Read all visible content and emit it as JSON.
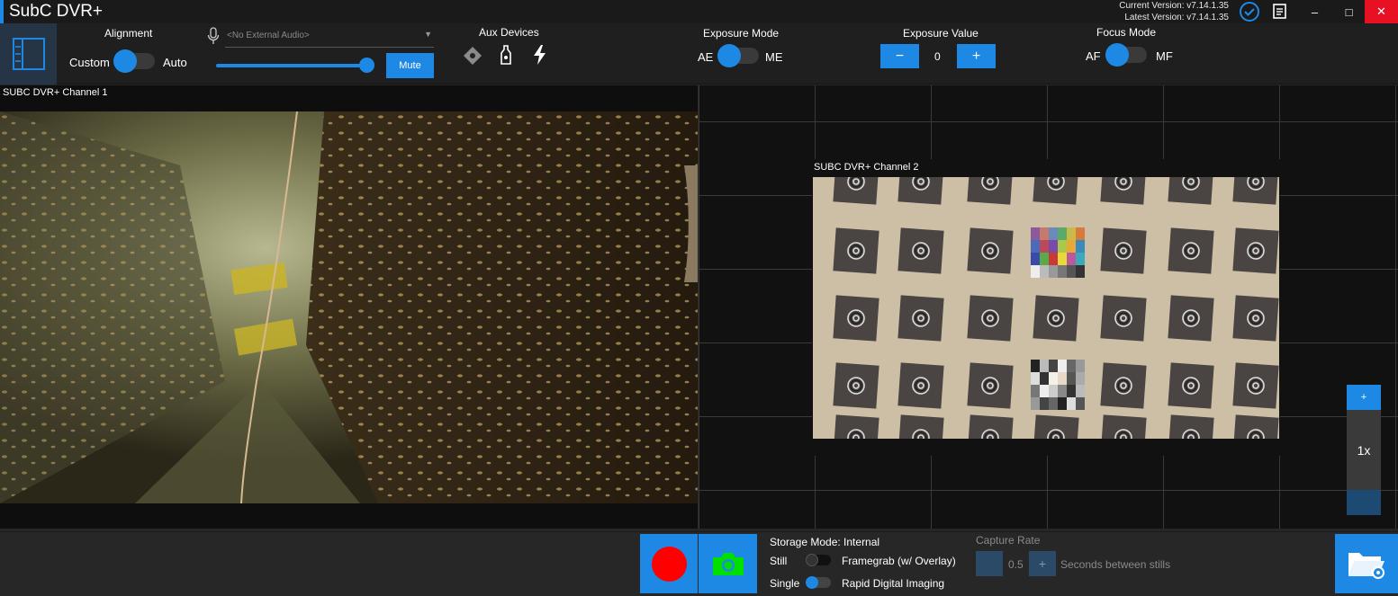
{
  "app": {
    "title": "SubC DVR+",
    "current_version": "Current Version: v7.14.1.35",
    "latest_version": "Latest Version: v7.14.1.35"
  },
  "toolbar": {
    "alignment": {
      "label": "Alignment",
      "left": "Custom",
      "right": "Auto"
    },
    "audio": {
      "placeholder": "<No External Audio>",
      "mute": "Mute"
    },
    "aux": {
      "label": "Aux Devices"
    },
    "exposure_mode": {
      "label": "Exposure Mode",
      "left": "AE",
      "right": "ME"
    },
    "exposure_value": {
      "label": "Exposure Value",
      "minus": "−",
      "value": "0",
      "plus": "+"
    },
    "focus_mode": {
      "label": "Focus Mode",
      "left": "AF",
      "right": "MF"
    }
  },
  "channels": {
    "ch1": "SUBC DVR+ Channel 1",
    "ch2": "SUBC DVR+ Channel 2"
  },
  "zoom": {
    "plus": "+",
    "level": "1x"
  },
  "bottom": {
    "storage_mode": "Storage Mode: Internal",
    "still": "Still",
    "framegrab": "Framegrab (w/ Overlay)",
    "single": "Single",
    "rdi": "Rapid Digital Imaging",
    "capture_rate_label": "Capture Rate",
    "capture_rate_value": "0.5",
    "seconds": "Seconds between stills"
  },
  "colors": {
    "accent": "#1e88e5",
    "record": "#ff0000",
    "camera": "#00e000"
  }
}
